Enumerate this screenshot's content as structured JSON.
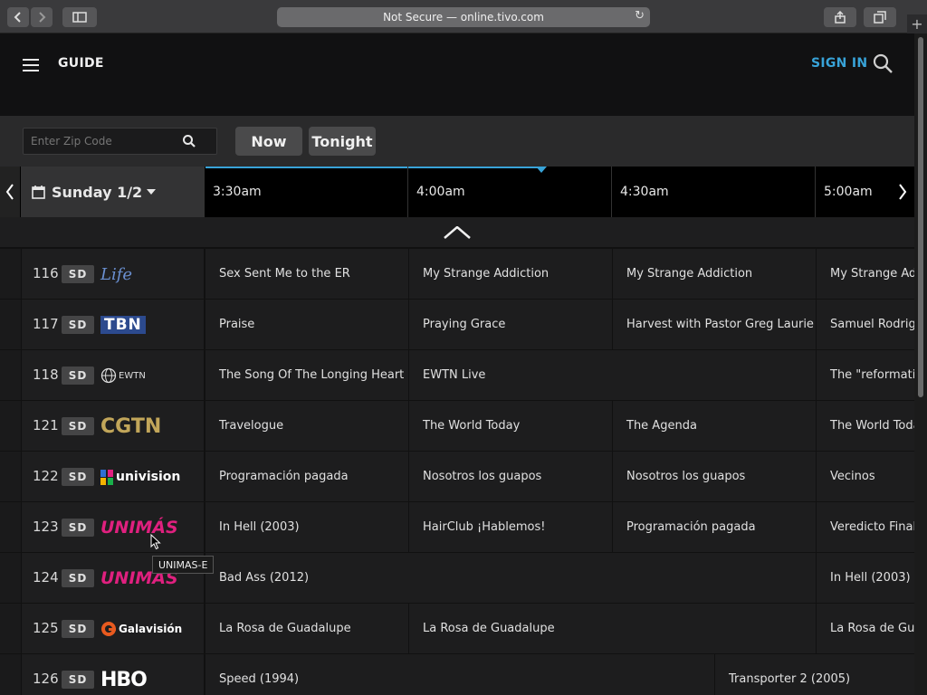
{
  "browser": {
    "address": "Not Secure — online.tivo.com",
    "back_icon": "chevron-left-icon",
    "forward_icon": "chevron-right-icon",
    "sidebar_icon": "sidebar-icon",
    "share_icon": "share-icon",
    "tabs_icon": "tabs-icon",
    "reload_icon": "reload-icon",
    "new_tab": "+"
  },
  "header": {
    "title": "GUIDE",
    "sign_in": "SIGN IN",
    "accent": "#38a3d8"
  },
  "controls": {
    "zip_placeholder": "Enter Zip Code",
    "now_label": "Now",
    "tonight_label": "Tonight"
  },
  "timebar": {
    "date": "Sunday 1/2",
    "slots": [
      "3:30am",
      "4:00am",
      "4:30am",
      "5:00am"
    ]
  },
  "channels": [
    {
      "number": "116",
      "quality": "SD",
      "logo": "Life",
      "logo_color": "#6a8fd0",
      "programs": [
        "Sex Sent Me to the ER",
        "My Strange Addiction",
        "My Strange Addiction",
        "My Strange Addiction"
      ]
    },
    {
      "number": "117",
      "quality": "SD",
      "logo": "TBN",
      "logo_color": "#ffffff",
      "programs": [
        "Praise",
        "Praying Grace",
        "Harvest with Pastor Greg Laurie",
        "Samuel Rodriguez"
      ]
    },
    {
      "number": "118",
      "quality": "SD",
      "logo": "EWTN",
      "logo_color": "#dddddd",
      "programs": [
        "The Song Of The Longing Heart",
        "EWTN Live",
        "The \"reformation\""
      ]
    },
    {
      "number": "121",
      "quality": "SD",
      "logo": "CGTN",
      "logo_color": "#c2a65a",
      "programs": [
        "Travelogue",
        "The World Today",
        "The Agenda",
        "The World Today"
      ]
    },
    {
      "number": "122",
      "quality": "SD",
      "logo": "univision",
      "logo_color": "#ffffff",
      "programs": [
        "Programación pagada",
        "Nosotros los guapos",
        "Nosotros los guapos",
        "Vecinos"
      ]
    },
    {
      "number": "123",
      "quality": "SD",
      "logo": "UNIMÁS",
      "logo_color": "#e0207f",
      "programs": [
        "In Hell (2003)",
        "HairClub ¡Hablemos!",
        "Programación pagada",
        "Veredicto Final"
      ]
    },
    {
      "number": "124",
      "quality": "SD",
      "logo": "UNIMÁS",
      "logo_color": "#e0207f",
      "programs": [
        "Bad Ass (2012)",
        "In Hell (2003)"
      ]
    },
    {
      "number": "125",
      "quality": "SD",
      "logo": "Galavisión",
      "logo_color": "#ffffff",
      "programs": [
        "La Rosa de Guadalupe",
        "La Rosa de Guadalupe",
        "La Rosa de Guadalupe"
      ]
    },
    {
      "number": "126",
      "quality": "SD",
      "logo": "HBO",
      "logo_color": "#ffffff",
      "programs": [
        "Speed (1994)",
        "Transporter 2 (2005)"
      ]
    }
  ],
  "tooltip": "UNIMAS-E"
}
